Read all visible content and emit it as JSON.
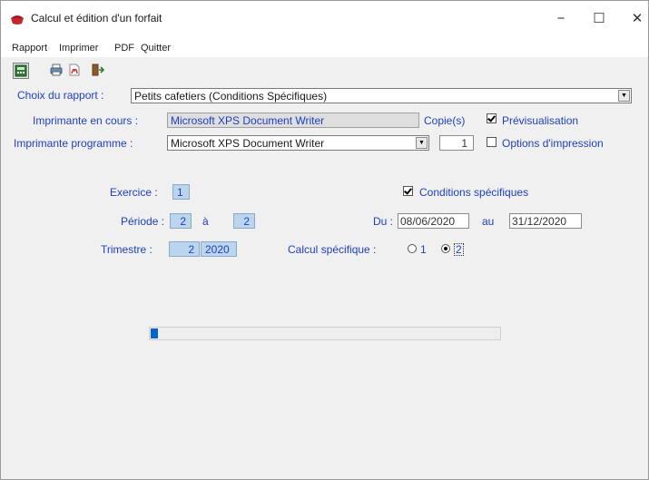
{
  "window": {
    "title": "Calcul et édition d'un forfait",
    "minimize_glyph": "−",
    "maximize_glyph": "☐",
    "close_glyph": "✕"
  },
  "menu": {
    "items": [
      "Rapport",
      "Imprimer",
      "PDF",
      "Quitter"
    ]
  },
  "toolbar": {
    "icons": [
      "calculator-icon",
      "printer-icon",
      "pdf-icon",
      "exit-icon"
    ]
  },
  "report": {
    "label": "Choix du rapport :",
    "value": "Petits cafetiers (Conditions Spécifiques)"
  },
  "printer_current": {
    "label": "Imprimante en cours :",
    "value": "Microsoft XPS Document Writer"
  },
  "printer_program": {
    "label": "Imprimante programme :",
    "value": "Microsoft XPS Document Writer"
  },
  "copies": {
    "label": "Copie(s)",
    "value": "1"
  },
  "preview": {
    "label": "Prévisualisation",
    "checked": true
  },
  "print_options": {
    "label": "Options d'impression",
    "checked": false
  },
  "exercice": {
    "label": "Exercice :",
    "value": "1"
  },
  "periode": {
    "label": "Période :",
    "from": "2",
    "to_label": "à",
    "to": "2"
  },
  "trimestre": {
    "label": "Trimestre :",
    "quarter": "2",
    "year": "2020"
  },
  "conditions": {
    "label": "Conditions spécifiques",
    "checked": true
  },
  "dates": {
    "from_label": "Du :",
    "from": "08/06/2020",
    "to_label": "au",
    "to": "31/12/2020"
  },
  "calcul": {
    "label": "Calcul spécifique :",
    "option1": "1",
    "option2": "2",
    "selected": "2"
  },
  "progress": {
    "fraction": 0.02
  },
  "colors": {
    "label_blue": "#1f3fbf",
    "field_blue_bg": "#bcd5ee",
    "progress_fill": "#0a63c9",
    "window_bg": "#f0f0f0"
  }
}
